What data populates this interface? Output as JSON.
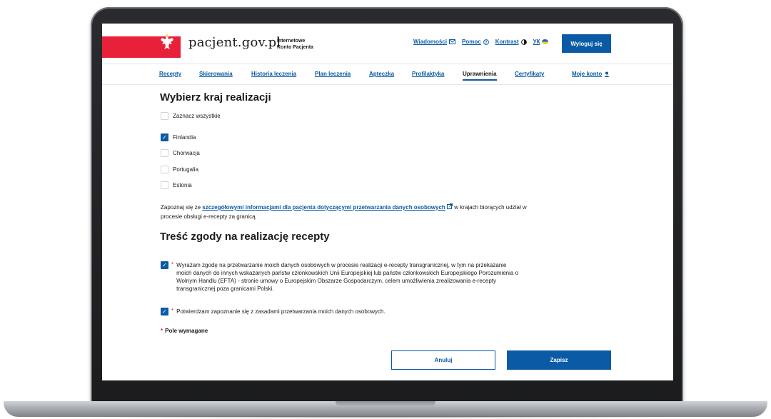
{
  "header": {
    "site_name": "pacjent.gov.pl",
    "site_sub_line1": "Internetowe",
    "site_sub_line2": "Konto Pacjenta",
    "links": {
      "messages": "Wiadomości",
      "help": "Pomoc",
      "contrast": "Kontrast",
      "language": "УК"
    },
    "logout_label": "Wyloguj się",
    "brand_red": "#e8203a",
    "accent_blue": "#0b5aa6"
  },
  "nav": {
    "items": [
      {
        "label": "Recepty"
      },
      {
        "label": "Skierowania"
      },
      {
        "label": "Historia leczenia"
      },
      {
        "label": "Plan leczenia"
      },
      {
        "label": "Apteczka"
      },
      {
        "label": "Profilaktyka"
      },
      {
        "label": "Uprawnienia",
        "active": true
      },
      {
        "label": "Certyfikaty"
      },
      {
        "label": "Moje konto"
      }
    ]
  },
  "country_section": {
    "title": "Wybierz kraj realizacji",
    "select_all": {
      "label": "Zaznacz wszystkie",
      "checked": false
    },
    "countries": [
      {
        "label": "Finlandia",
        "checked": true
      },
      {
        "label": "Chorwacja",
        "checked": false
      },
      {
        "label": "Portugalia",
        "checked": false
      },
      {
        "label": "Estonia",
        "checked": false
      }
    ],
    "info_prefix": "Zapoznaj się ze",
    "info_link": "szczegółowymi informacjami dla pacjenta dotyczącymi przetwarzania danych osobowych",
    "info_suffix": "w krajach biorących udział w procesie obsługi e-recepty za granicą."
  },
  "consent_section": {
    "title": "Treść zgody na realizację recepty",
    "consent1": {
      "text": "Wyrażam zgodę na przetwarzanie moich danych osobowych w procesie realizacji e-recepty transgranicznej, w tym na przekazanie moich danych do innych wskazanych państw członkowskich Unii Europejskiej lub państw członkowskich Europejskiego Porozumienia o Wolnym Handlu (EFTA) - stronie umowy o Europejskim Obszarze Gospodarczym, celem umożliwienia zrealizowania e-recepty transgranicznej poza granicami Polski.",
      "checked": true
    },
    "consent2": {
      "text": "Potwierdzam zapoznanie się z zasadami przetwarzania moich danych osobowych.",
      "checked": true
    },
    "required_note": "Pole wymagane",
    "required_marker": "*"
  },
  "actions": {
    "cancel_label": "Anuluj",
    "save_label": "Zapisz"
  }
}
